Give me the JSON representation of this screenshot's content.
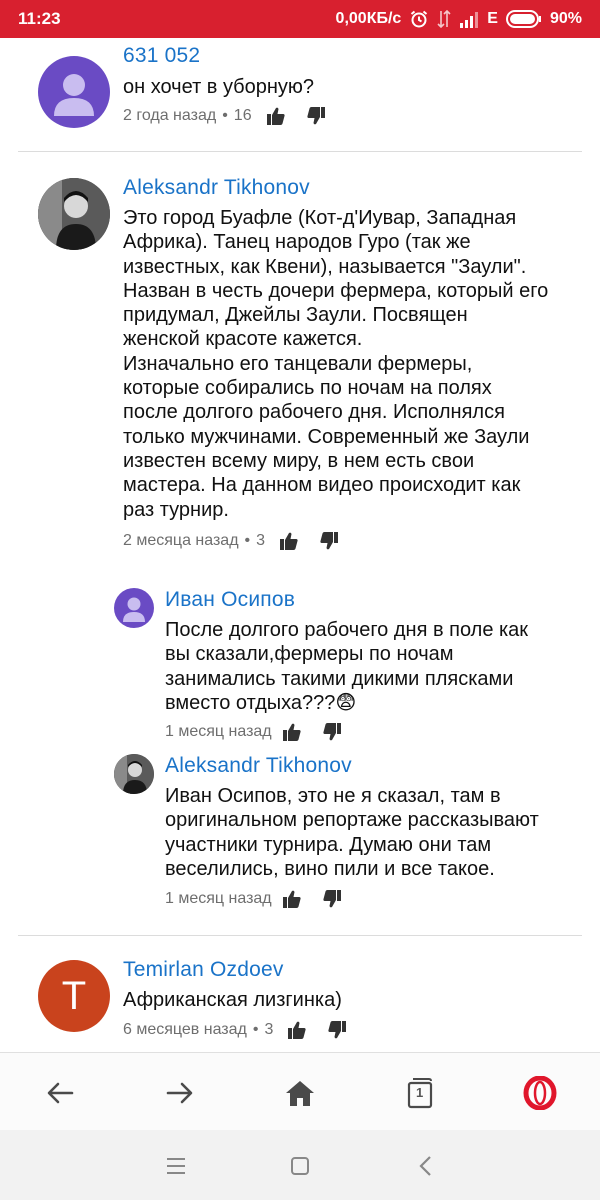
{
  "status_bar": {
    "time": "11:23",
    "network_speed": "0,00КБ/с",
    "network_type": "E",
    "battery": "90%",
    "icons": [
      "alarm-icon",
      "signal-transfer-icon",
      "signal-icon",
      "battery-icon"
    ]
  },
  "comments": [
    {
      "author": "631 052",
      "text": "он хочет в уборную?",
      "time": "2 года назад",
      "likes": "16",
      "avatar_color": "#6a4bc4"
    },
    {
      "author": "Aleksandr Tikhonov",
      "text": "Это город Буафле (Кот-д'Иувар, Западная\nАфрика). Танец народов Гуро (так же\nизвестных, как Квени), называется \"Заули\".\nНазван в честь дочери фермера, который его\nпридумал, Джейлы Заули. Посвящен\nженской красоте кажется.\nИзначально его танцевали фермеры,\nкоторые собирались по ночам на полях\nпосле долгого рабочего дня. Исполнялся\nтолько мужчинами. Современный же Заули\nизвестен всему миру, в нем есть свои\nмастера. На данном видео происходит как\nраз турнир.",
      "time": "2 месяца назад",
      "likes": "3"
    },
    {
      "author": "Иван Осипов",
      "text": "После долгого рабочего дня в поле как\nвы сказали,фермеры по ночам\nзанимались такими дикими плясками\nвместо отдыха???",
      "emoji": "😨",
      "time": "1 месяц назад",
      "avatar_color": "#6a4bc4"
    },
    {
      "author": "Aleksandr Tikhonov",
      "text": "Иван Осипов, это не я сказал, там в\nоригинальном репортаже рассказывают\nучастники турнира. Думаю они там\nвеселились, вино пили и все такое.",
      "time": "1 месяц назад"
    },
    {
      "author": "Temirlan Ozdoev",
      "text": "Африканская лизгинка)",
      "time": "6 месяцев назад",
      "likes": "3",
      "avatar_letter": "T",
      "avatar_color": "#c9431d"
    }
  ],
  "meta_separator": "•",
  "browser_bar": {
    "tab_count": "1",
    "icons": [
      "back-arrow-icon",
      "forward-arrow-icon",
      "home-icon",
      "tabs-icon",
      "opera-icon"
    ],
    "accent": "#e0162b"
  },
  "colors": {
    "status_bar": "#d8202f",
    "author_link": "#1a73c8",
    "meta_text": "#6e6e6e"
  }
}
